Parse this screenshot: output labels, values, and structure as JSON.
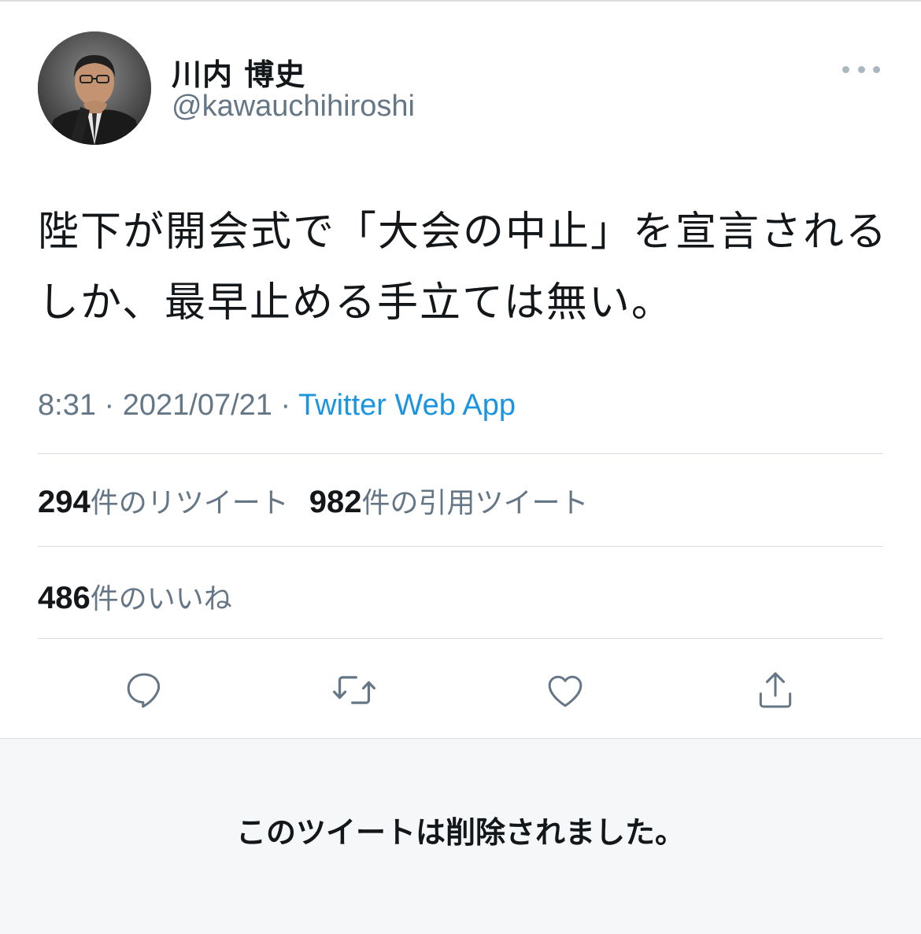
{
  "author": {
    "display_name": "川内 博史",
    "handle": "@kawauchihiroshi"
  },
  "tweet": {
    "text": "陛下が開会式で「大会の中止」を宣言されるしか、最早止める手立ては無い。",
    "time": "8:31",
    "date": "2021/07/21",
    "separator": " · ",
    "source": "Twitter Web App"
  },
  "stats": {
    "retweets": {
      "count": "294",
      "label": "件のリツイート"
    },
    "quotes": {
      "count": "982",
      "label": "件の引用ツイート"
    },
    "likes": {
      "count": "486",
      "label": "件のいいね"
    }
  },
  "actions": [
    {
      "icon": "reply-icon"
    },
    {
      "icon": "retweet-icon"
    },
    {
      "icon": "like-icon"
    },
    {
      "icon": "share-icon"
    }
  ],
  "deleted_notice": "このツイートは削除されました。",
  "colors": {
    "text": "#14171a",
    "secondary": "#657786",
    "link": "#1b95e0",
    "icon": "#657786",
    "divider": "#d6dbdf",
    "panel_bg": "#f5f7f9"
  }
}
